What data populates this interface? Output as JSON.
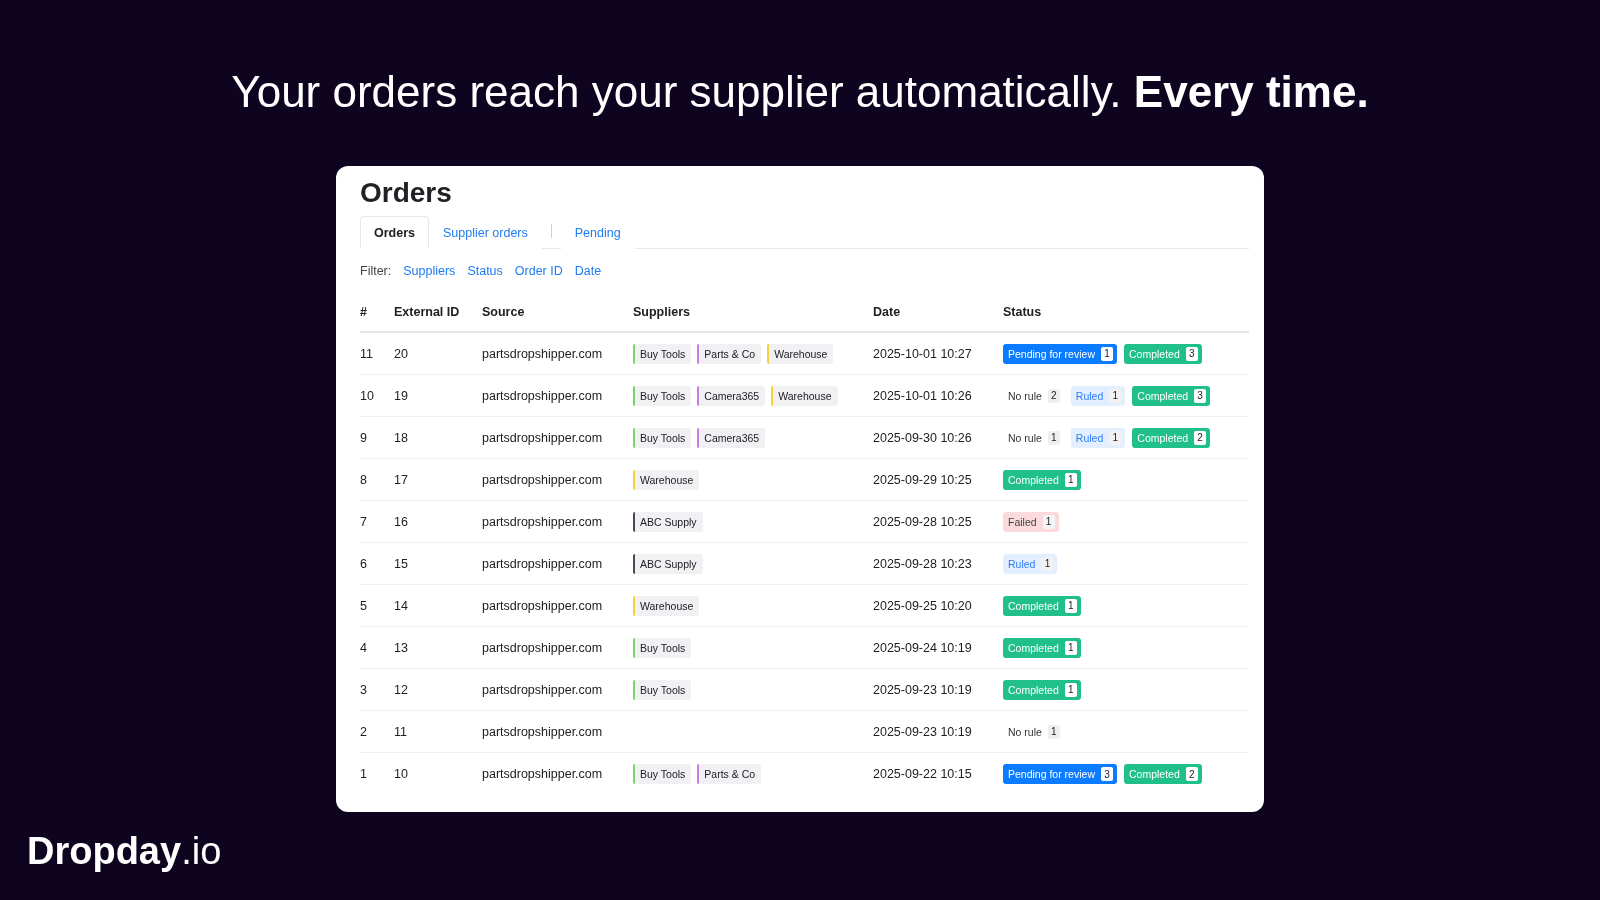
{
  "headline": "Your orders reach your supplier automatically. **Every time.**",
  "page": {
    "title": "Orders",
    "tabs": [
      {
        "label": "Orders",
        "selected": true,
        "divider_before": false
      },
      {
        "label": "Supplier orders",
        "selected": false,
        "divider_before": false
      },
      {
        "label": "Pending",
        "selected": false,
        "divider_before": true
      }
    ],
    "filter": {
      "label": "Filter:",
      "options": [
        "Suppliers",
        "Status",
        "Order ID",
        "Date"
      ]
    }
  },
  "table": {
    "columns": [
      "#",
      "External ID",
      "Source",
      "Suppliers",
      "Date",
      "Status"
    ],
    "rows": [
      {
        "number": "11",
        "external_id": "20",
        "source": "partsdropshipper.com",
        "suppliers": [
          {
            "name": "Buy Tools",
            "color": "#7ad26c"
          },
          {
            "name": "Parts & Co",
            "color": "#c67ce6"
          },
          {
            "name": "Warehouse",
            "color": "#f3d23a"
          }
        ],
        "date": "2025-10-01 10:27",
        "statuses": [
          {
            "kind": "pending",
            "label": "Pending for review",
            "count": "1"
          },
          {
            "kind": "completed",
            "label": "Completed",
            "count": "3"
          }
        ]
      },
      {
        "number": "10",
        "external_id": "19",
        "source": "partsdropshipper.com",
        "suppliers": [
          {
            "name": "Buy Tools",
            "color": "#7ad26c"
          },
          {
            "name": "Camera365",
            "color": "#c67ce6"
          },
          {
            "name": "Warehouse",
            "color": "#f3d23a"
          }
        ],
        "date": "2025-10-01 10:26",
        "statuses": [
          {
            "kind": "no_rule",
            "label": "No rule",
            "count": "2"
          },
          {
            "kind": "ruled",
            "label": "Ruled",
            "count": "1"
          },
          {
            "kind": "completed",
            "label": "Completed",
            "count": "3"
          }
        ]
      },
      {
        "number": "9",
        "external_id": "18",
        "source": "partsdropshipper.com",
        "suppliers": [
          {
            "name": "Buy Tools",
            "color": "#7ad26c"
          },
          {
            "name": "Camera365",
            "color": "#c67ce6"
          }
        ],
        "date": "2025-09-30 10:26",
        "statuses": [
          {
            "kind": "no_rule",
            "label": "No rule",
            "count": "1"
          },
          {
            "kind": "ruled",
            "label": "Ruled",
            "count": "1"
          },
          {
            "kind": "completed",
            "label": "Completed",
            "count": "2"
          }
        ]
      },
      {
        "number": "8",
        "external_id": "17",
        "source": "partsdropshipper.com",
        "suppliers": [
          {
            "name": "Warehouse",
            "color": "#f3d23a"
          }
        ],
        "date": "2025-09-29 10:25",
        "statuses": [
          {
            "kind": "completed",
            "label": "Completed",
            "count": "1"
          }
        ]
      },
      {
        "number": "7",
        "external_id": "16",
        "source": "partsdropshipper.com",
        "suppliers": [
          {
            "name": "ABC Supply",
            "color": "#4a4a56"
          }
        ],
        "date": "2025-09-28 10:25",
        "statuses": [
          {
            "kind": "failed",
            "label": "Failed",
            "count": "1"
          }
        ]
      },
      {
        "number": "6",
        "external_id": "15",
        "source": "partsdropshipper.com",
        "suppliers": [
          {
            "name": "ABC Supply",
            "color": "#4a4a56"
          }
        ],
        "date": "2025-09-28 10:23",
        "statuses": [
          {
            "kind": "ruled",
            "label": "Ruled",
            "count": "1"
          }
        ]
      },
      {
        "number": "5",
        "external_id": "14",
        "source": "partsdropshipper.com",
        "suppliers": [
          {
            "name": "Warehouse",
            "color": "#f3d23a"
          }
        ],
        "date": "2025-09-25 10:20",
        "statuses": [
          {
            "kind": "completed",
            "label": "Completed",
            "count": "1"
          }
        ]
      },
      {
        "number": "4",
        "external_id": "13",
        "source": "partsdropshipper.com",
        "suppliers": [
          {
            "name": "Buy Tools",
            "color": "#7ad26c"
          }
        ],
        "date": "2025-09-24 10:19",
        "statuses": [
          {
            "kind": "completed",
            "label": "Completed",
            "count": "1"
          }
        ]
      },
      {
        "number": "3",
        "external_id": "12",
        "source": "partsdropshipper.com",
        "suppliers": [
          {
            "name": "Buy Tools",
            "color": "#7ad26c"
          }
        ],
        "date": "2025-09-23 10:19",
        "statuses": [
          {
            "kind": "completed",
            "label": "Completed",
            "count": "1"
          }
        ]
      },
      {
        "number": "2",
        "external_id": "11",
        "source": "partsdropshipper.com",
        "date": "2025-09-23 10:19",
        "statuses": [
          {
            "kind": "no_rule",
            "label": "No rule",
            "count": "1"
          }
        ]
      },
      {
        "number": "1",
        "external_id": "10",
        "source": "partsdropshipper.com",
        "suppliers": [
          {
            "name": "Buy Tools",
            "color": "#7ad26c"
          },
          {
            "name": "Parts & Co",
            "color": "#c67ce6"
          }
        ],
        "date": "2025-09-22 10:15",
        "statuses": [
          {
            "kind": "pending",
            "label": "Pending for review",
            "count": "3"
          },
          {
            "kind": "completed",
            "label": "Completed",
            "count": "2"
          }
        ]
      }
    ]
  },
  "brand": {
    "logo": "**Dropday**.io"
  }
}
